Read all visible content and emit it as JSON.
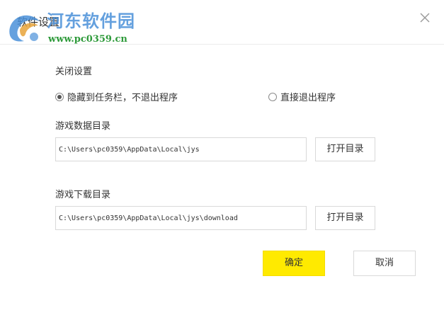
{
  "dialog": {
    "title": "软件设置",
    "close_icon": "close-icon"
  },
  "watermark": {
    "name": "河东软件园",
    "url": "www.pc0359.cn",
    "logo_icon": "watermark-logo-icon"
  },
  "close_settings": {
    "label": "关闭设置",
    "options": [
      {
        "label": "隐藏到任务栏，不退出程序",
        "selected": true
      },
      {
        "label": "直接退出程序",
        "selected": false
      }
    ]
  },
  "game_data_dir": {
    "label": "游戏数据目录",
    "value": "C:\\Users\\pc0359\\AppData\\Local\\jys",
    "button_label": "打开目录"
  },
  "game_download_dir": {
    "label": "游戏下载目录",
    "value": "C:\\Users\\pc0359\\AppData\\Local\\jys\\download",
    "button_label": "打开目录"
  },
  "footer": {
    "ok_label": "确定",
    "cancel_label": "取消"
  },
  "colors": {
    "accent": "#ffea00",
    "watermark_blue": "#4a90d9",
    "watermark_green": "#2e9a3a"
  }
}
